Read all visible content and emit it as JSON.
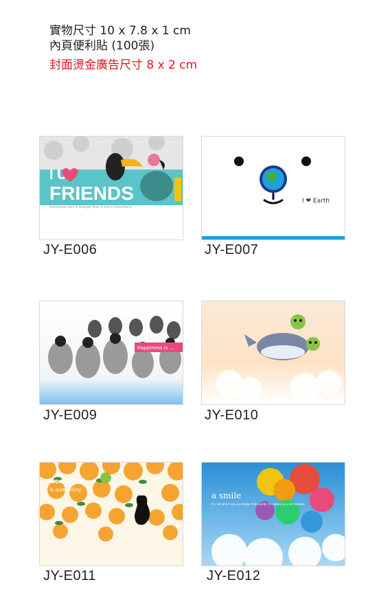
{
  "specs": {
    "line1": "實物尺寸 10 x 7.8 x 1 cm",
    "line2": "內頁便利貼 (100張)",
    "line3": "封面燙金廣告尺寸 8 x 2 cm"
  },
  "products": [
    {
      "code": "JY-E006",
      "art_text": "I  U FRIENDS",
      "tagline": "Sometimes love is stronger than a man's convictions."
    },
    {
      "code": "JY-E007",
      "art_text": "I ❤ Earth"
    },
    {
      "code": "JY-E009",
      "art_text": "Happiness is ..."
    },
    {
      "code": "JY-E010"
    },
    {
      "code": "JY-E011",
      "art_text": "Good Life",
      "art_sub": "is everyday"
    },
    {
      "code": "JY-E012",
      "art_text": "a smile",
      "art_sub": "It's not where you are today that counts. It's where you are headed."
    }
  ],
  "colors": {
    "spec_red": "#e0161d",
    "earth_blue": "#1ea0dc",
    "friends_teal": "#5bc4c8"
  }
}
